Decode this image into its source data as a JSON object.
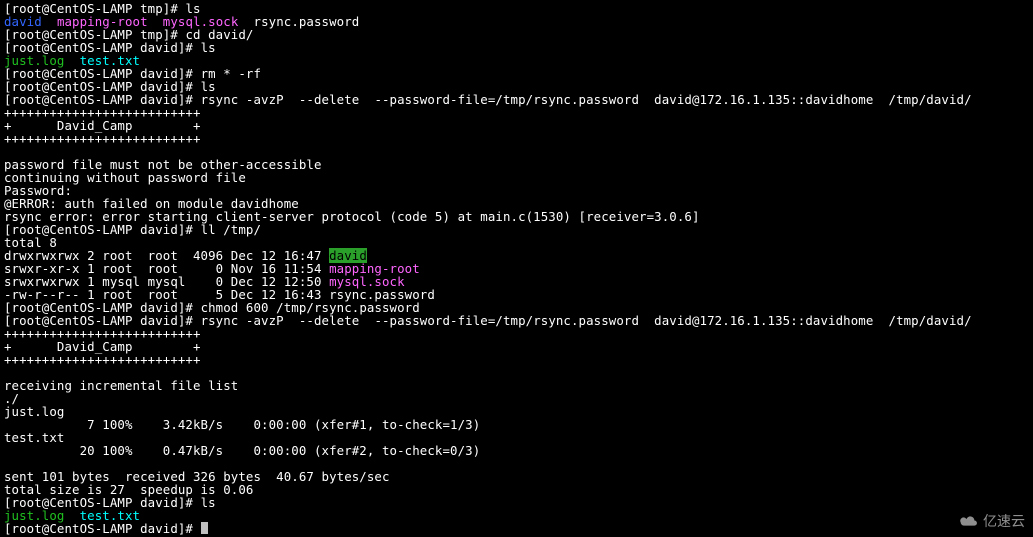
{
  "host": "CentOS-LAMP",
  "user": "root",
  "prompts": {
    "tmp": "[root@CentOS-LAMP tmp]# ",
    "david": "[root@CentOS-LAMP david]# "
  },
  "commands": {
    "ls": "ls",
    "cd_david": "cd david/",
    "rm_rf": "rm * -rf",
    "rsync": "rsync -avzP  --delete  --password-file=/tmp/rsync.password  david@172.16.1.135::davidhome  /tmp/david/",
    "ll_tmp": "ll /tmp/",
    "chmod": "chmod 600 /tmp/rsync.password"
  },
  "ls_tmp": {
    "david": "david",
    "mapping_root": "mapping-root",
    "mysql_sock": "mysql.sock",
    "rsync_pwd": "rsync.password"
  },
  "ls_david": {
    "just_log": "just.log",
    "test_txt": "test.txt"
  },
  "banner": {
    "rule": "++++++++++++++++++++++++++",
    "mid": "+      David_Camp        +"
  },
  "errors": {
    "pwd_other": "password file must not be other-accessible",
    "cont_no_pwd": "continuing without password file",
    "password_prompt": "Password: ",
    "auth_failed": "@ERROR: auth failed on module davidhome",
    "proto": "rsync error: error starting client-server protocol (code 5) at main.c(1530) [receiver=3.0.6]"
  },
  "ll": {
    "total": "total 8",
    "rows": [
      {
        "perm": "drwxrwxrwx 2 root  root  4096 Dec 12 16:47 ",
        "name": "david",
        "class": "hi"
      },
      {
        "perm": "srwxr-xr-x 1 root  root     0 Nov 16 11:54 ",
        "name": "mapping-root",
        "class": "pink"
      },
      {
        "perm": "srwxrwxrwx 1 mysql mysql    0 Dec 12 12:50 ",
        "name": "mysql.sock",
        "class": "pink"
      },
      {
        "perm": "-rw-r--r-- 1 root  root     5 Dec 12 16:43 rsync.password",
        "name": "",
        "class": ""
      }
    ]
  },
  "transfer": {
    "recv": "receiving incremental file list",
    "dot": "./",
    "f1": "just.log",
    "l1": "           7 100%    3.42kB/s    0:00:00 (xfer#1, to-check=1/3)",
    "f2": "test.txt",
    "l2": "          20 100%    0.47kB/s    0:00:00 (xfer#2, to-check=0/3)"
  },
  "summary": {
    "s1": "sent 101 bytes  received 326 bytes  40.67 bytes/sec",
    "s2": "total size is 27  speedup is 0.06"
  },
  "watermark": "亿速云"
}
